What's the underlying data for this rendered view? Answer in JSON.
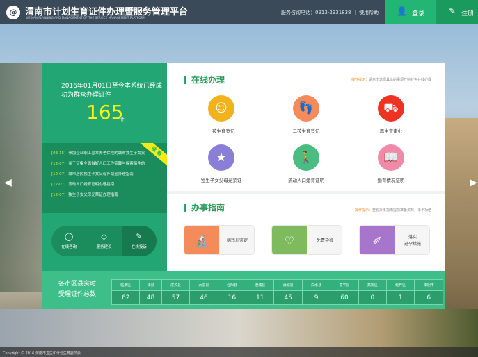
{
  "header": {
    "logo_text": "@",
    "title": "渭南市计划生育证件办理暨服务管理平台",
    "subtitle": "WEINAN PLANNING AND MANAGEMENT OF THE SERVICE MANAGEMENT PLATFORM",
    "hotline": "服务咨询电话：0913-2931838 ｜ 使用帮助",
    "login": "登录",
    "register": "注册"
  },
  "stats": {
    "text": "2016年01月01日至今本系统已经成功为群众办理证件",
    "count": "165",
    "unit": "件"
  },
  "policy": {
    "ribbon": "政 策",
    "items": [
      {
        "date": "[03-15]",
        "title": "参加企业职工基本养老保险的城市独生子女父"
      },
      {
        "date": "[12-07]",
        "title": "关于证集全面做好人口工作实践与探索稿件的"
      },
      {
        "date": "[12-07]",
        "title": "城市居民独生子女父母补助金办理指南"
      },
      {
        "date": "[12-07]",
        "title": "流动人口婚育证明办理指南"
      },
      {
        "date": "[12-07]",
        "title": "独生子女父母光荣证办理指南"
      }
    ]
  },
  "tools": [
    {
      "label": "在线咨询"
    },
    {
      "label": "服务建议"
    },
    {
      "label": "在线投诉"
    }
  ],
  "online": {
    "title": "在线办理",
    "tip_label": "操作提示：",
    "tip": "请点击选择具体的事项开始业务在线办理",
    "items": [
      {
        "label": "一孩生育登记",
        "color": "#f2b21c"
      },
      {
        "label": "二孩生育登记",
        "color": "#f58b5a"
      },
      {
        "label": "再生育审批",
        "color": "#ee3322"
      },
      {
        "label": "独生子女父母光荣证",
        "color": "#8a7fd6"
      },
      {
        "label": "流动人口婚育证明",
        "color": "#4bbd83"
      },
      {
        "label": "婚育情况证明",
        "color": "#ef8aa8"
      }
    ]
  },
  "guide": {
    "title": "办事指南",
    "tip_label": "操作提示：",
    "tip": "查看办事指南提前准备资料，事半功倍",
    "items": [
      {
        "label": "病残儿鉴定",
        "color": "#f58b5a"
      },
      {
        "label": "免费孕检",
        "color": "#7dbb5e"
      },
      {
        "label": "落实避孕措施",
        "line1": "落实",
        "line2": "避孕措施",
        "color": "#a775cc"
      }
    ]
  },
  "district": {
    "title1": "各市区县实时",
    "title2": "受理证件总数",
    "names": [
      "临渭区",
      "华县",
      "潼关县",
      "大荔县",
      "合阳县",
      "澄城县",
      "蒲城县",
      "白水县",
      "富平县",
      "高新区",
      "经开区",
      "华阴市"
    ],
    "values": [
      "62",
      "48",
      "57",
      "46",
      "16",
      "11",
      "45",
      "9",
      "60",
      "0",
      "1",
      "6"
    ]
  },
  "footer": "Copyright © 2016 渭南市卫生和计划生育委员会"
}
